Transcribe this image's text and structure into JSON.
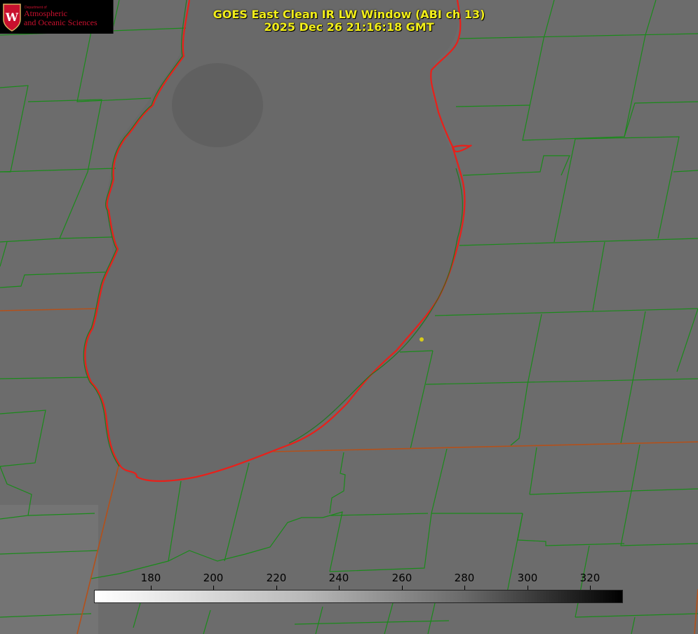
{
  "title_line1": "GOES East Clean IR LW Window (ABI ch 13)",
  "title_line2": "2025 Dec 26 21:16:18 GMT",
  "logo": {
    "department": "Department of",
    "line1": "Atmospheric",
    "line2": "and Oceanic Sciences",
    "emblem": "uw-crest-icon"
  },
  "colorbar": {
    "ticks": [
      "180",
      "200",
      "220",
      "240",
      "260",
      "280",
      "300",
      "320"
    ]
  },
  "colors": {
    "title": "#f2ee1a",
    "county_borders": "#1a8a1a",
    "shoreline": "#e8201a",
    "state_border": "#c0501a",
    "station_marker": "#d8cc1a",
    "background": "#6e6e6e"
  }
}
